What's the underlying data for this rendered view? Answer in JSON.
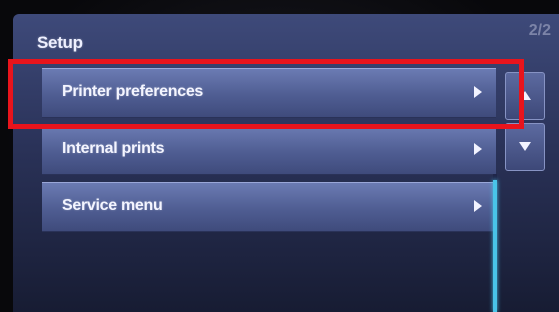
{
  "screen": {
    "title": "Setup",
    "page_indicator": "2/2"
  },
  "menu": {
    "items": [
      {
        "label": "Printer preferences",
        "icon": "chevron-right-icon"
      },
      {
        "label": "Internal prints",
        "icon": "chevron-right-icon"
      },
      {
        "label": "Service menu",
        "icon": "chevron-right-icon"
      }
    ]
  },
  "scrollbar": {
    "up_icon": "scroll-up-icon",
    "down_icon": "scroll-down-icon",
    "thumb_color": "#49c4e8"
  },
  "annotation": {
    "highlight_color": "#e8141c",
    "highlighted_item": "Printer preferences"
  },
  "colors": {
    "screen_top": "#3e4a7a",
    "item_face": "#5f6ea6"
  }
}
